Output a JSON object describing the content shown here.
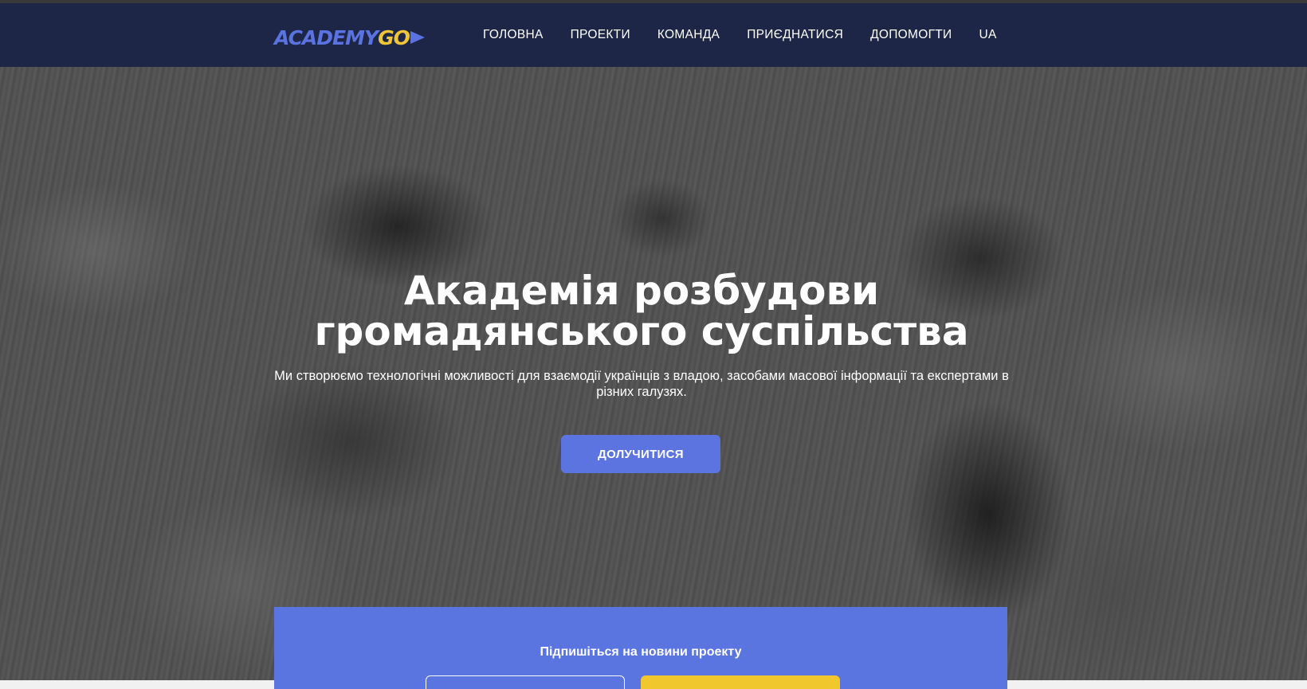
{
  "logo": {
    "part1": "ACADEMY",
    "part2": "GO"
  },
  "nav": {
    "items": [
      {
        "label": "ГОЛОВНА"
      },
      {
        "label": "ПРОЕКТИ"
      },
      {
        "label": "КОМАНДА"
      },
      {
        "label": "ПРИЄДНАТИСЯ"
      },
      {
        "label": "ДОПОМОГТИ"
      },
      {
        "label": "UA"
      }
    ]
  },
  "hero": {
    "title_line1": "Академія розбудови",
    "title_line2": "громадянського суспільства",
    "subtitle": "Ми створюємо технологічні можливості для взаємодії українців з владою, засобами масової інформації та експертами в різних галузях.",
    "cta_label": "ДОЛУЧИТИСЯ"
  },
  "subscribe": {
    "title": "Підпишіться на новини проекту"
  },
  "colors": {
    "header_bg": "#1e2647",
    "accent_blue": "#5a75e0",
    "accent_yellow": "#f0c82e"
  }
}
